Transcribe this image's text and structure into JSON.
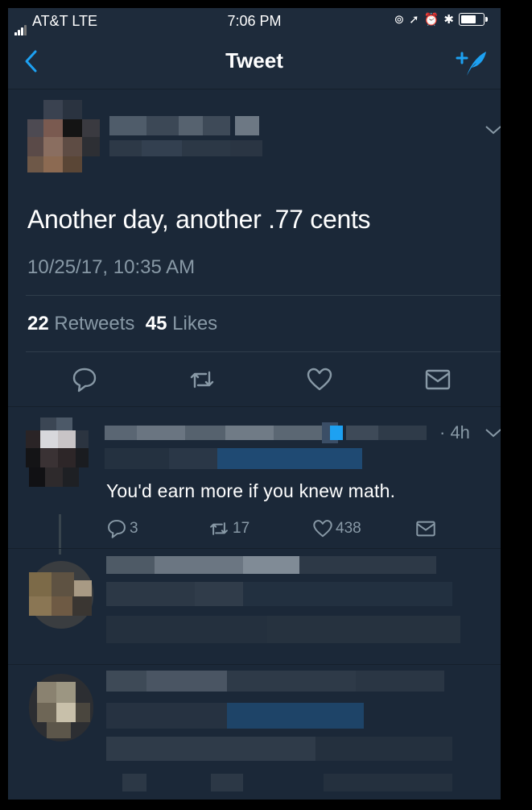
{
  "status_bar": {
    "carrier": "AT&T  LTE",
    "time": "7:06 PM",
    "icons": [
      "lock-rotation-icon",
      "location-icon",
      "alarm-icon",
      "bluetooth-icon",
      "battery-icon"
    ]
  },
  "nav": {
    "title": "Tweet"
  },
  "tweet": {
    "text": "Another day, another .77 cents",
    "timestamp": "10/25/17, 10:35 AM",
    "retweets_count": "22",
    "retweets_label": "Retweets",
    "likes_count": "45",
    "likes_label": "Likes"
  },
  "reply": {
    "ago": "· 4h",
    "text": "You'd earn more if you knew math.",
    "replies": "3",
    "retweets": "17",
    "likes": "438"
  },
  "colors": {
    "background": "#1b2838",
    "accent": "#1da1f2",
    "muted": "#8899a6"
  }
}
